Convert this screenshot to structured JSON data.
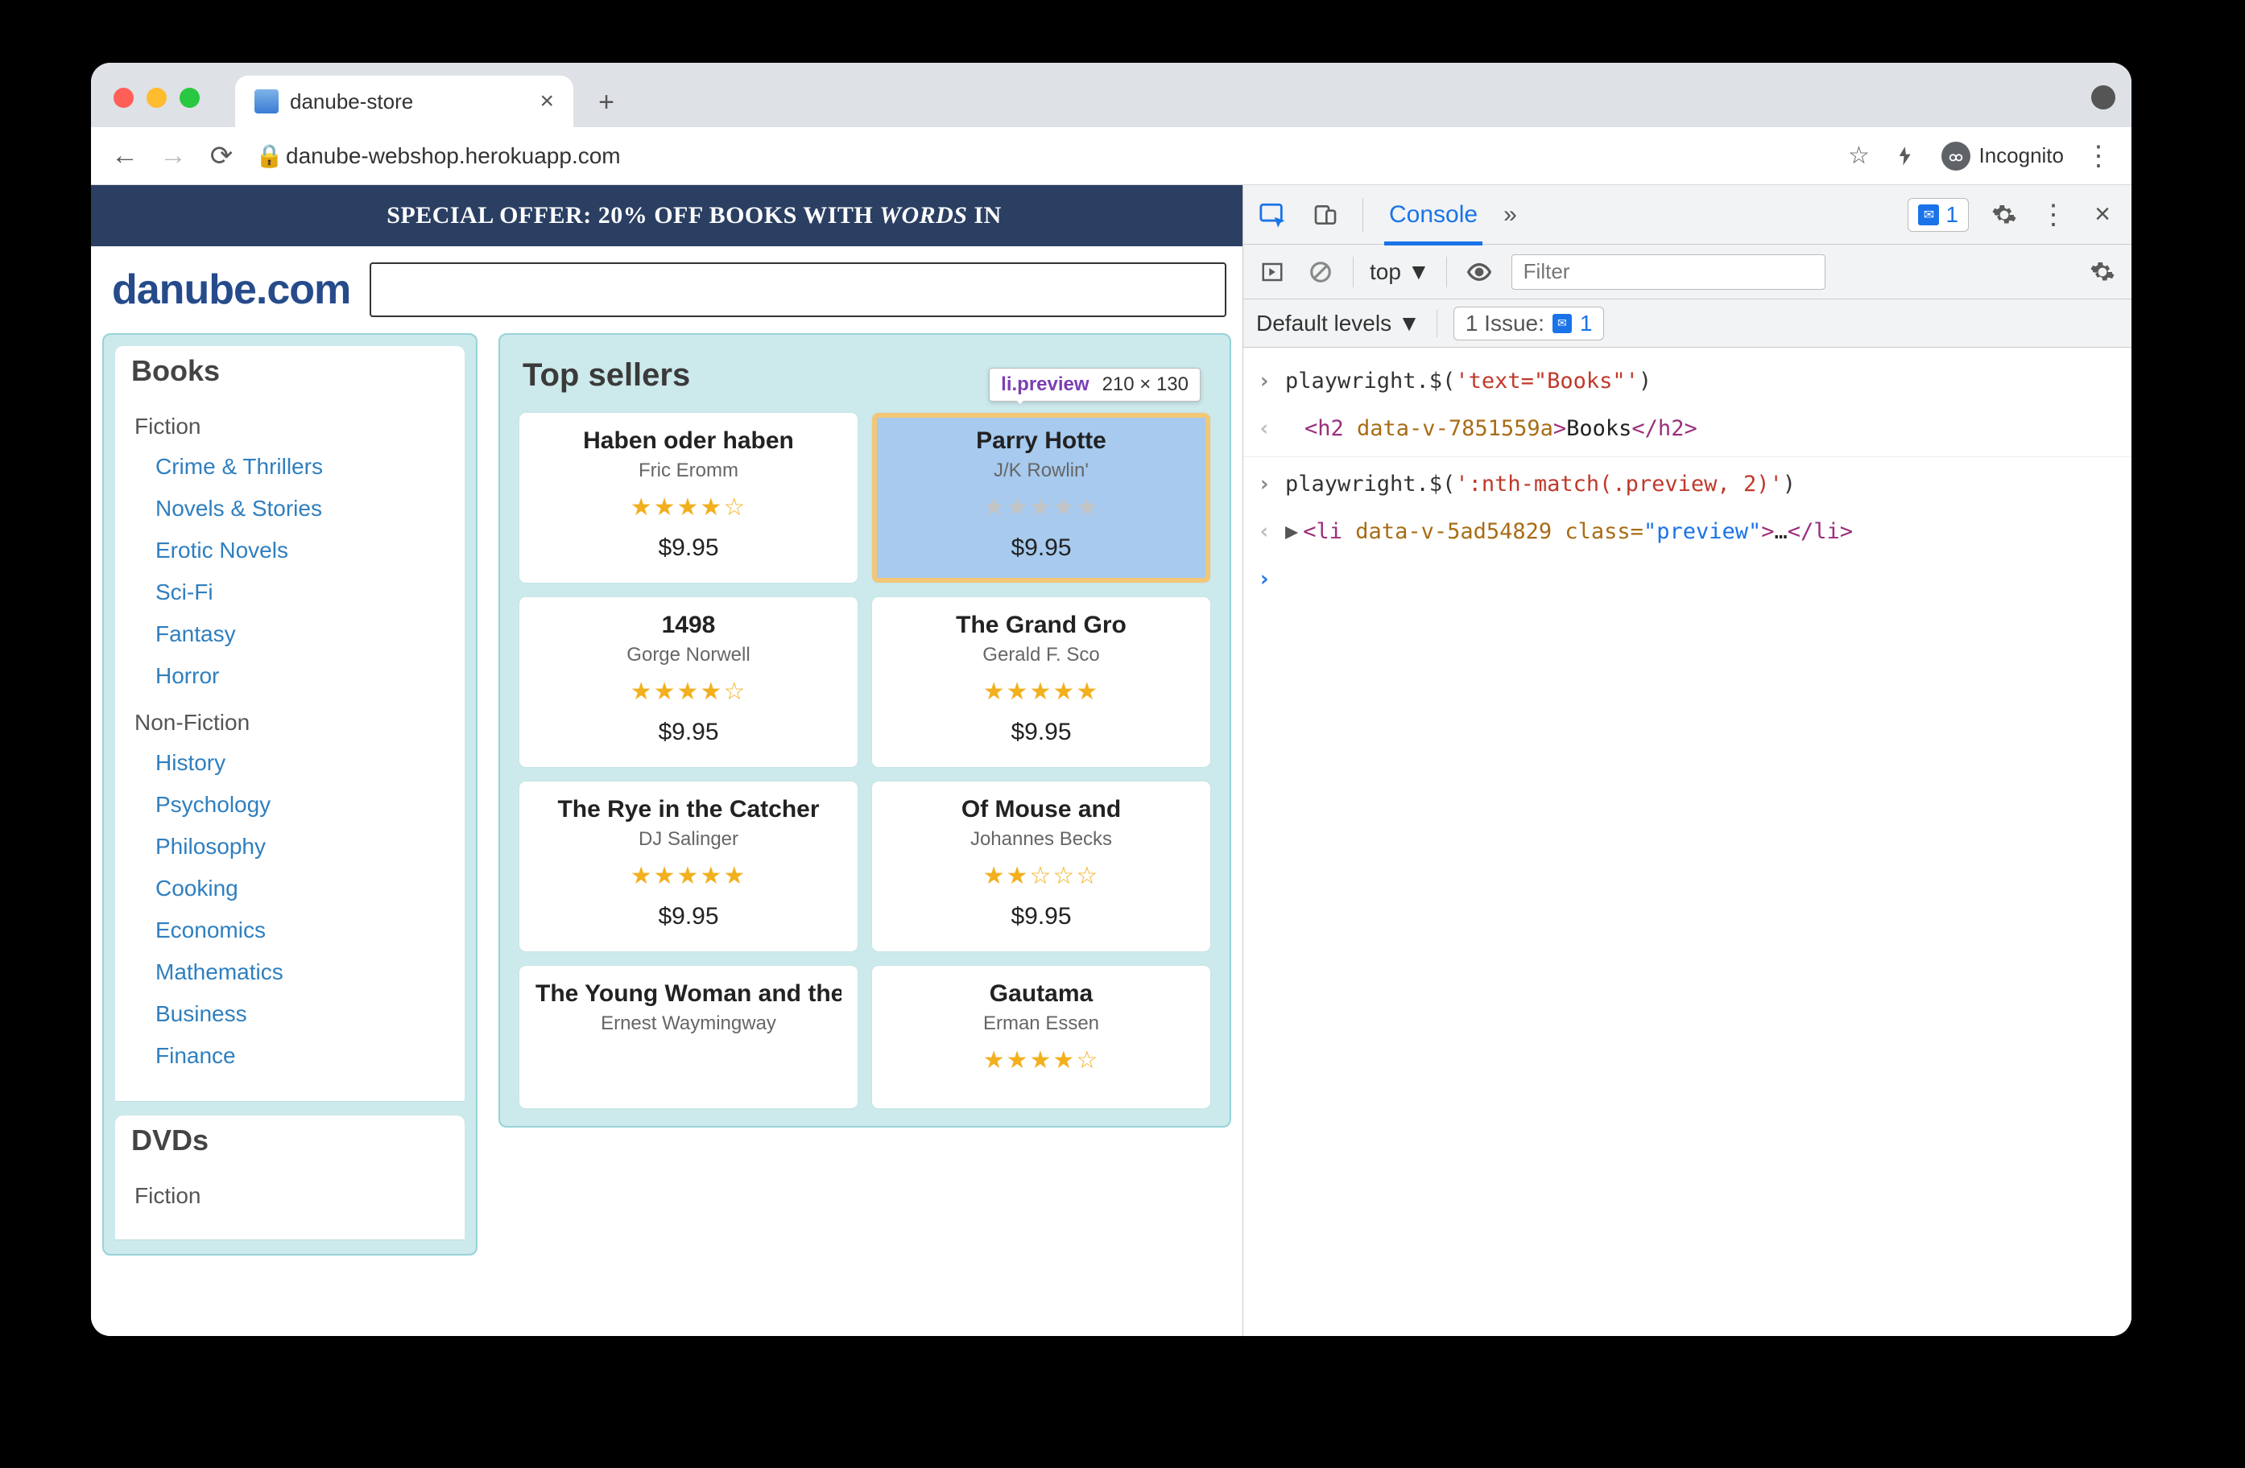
{
  "browser": {
    "tab_title": "danube-store",
    "url": "danube-webshop.herokuapp.com",
    "incognito_label": "Incognito"
  },
  "page": {
    "banner_prefix": "SPECIAL OFFER: 20% OFF BOOKS WITH ",
    "banner_em": "WORDS",
    "banner_suffix": " IN",
    "logo": "danube.com",
    "tooltip_tag": "li.preview",
    "tooltip_dims": "210 × 130",
    "sidebar": {
      "blocks": [
        {
          "title": "Books",
          "groups": [
            {
              "heading": "Fiction",
              "links": [
                "Crime & Thrillers",
                "Novels & Stories",
                "Erotic Novels",
                "Sci-Fi",
                "Fantasy",
                "Horror"
              ]
            },
            {
              "heading": "Non-Fiction",
              "links": [
                "History",
                "Psychology",
                "Philosophy",
                "Cooking",
                "Economics",
                "Mathematics",
                "Business",
                "Finance"
              ]
            }
          ]
        },
        {
          "title": "DVDs",
          "groups": [
            {
              "heading": "Fiction",
              "links": []
            }
          ]
        }
      ]
    },
    "main_heading": "Top sellers",
    "products": [
      {
        "title": "Haben oder haben",
        "author": "Fric Eromm",
        "price": "$9.95",
        "stars": "★★★★☆",
        "highlight": false
      },
      {
        "title": "Parry Hotte",
        "author": "J/K Rowlin'",
        "price": "$9.95",
        "stars": "★★★★★",
        "highlight": true
      },
      {
        "title": "1498",
        "author": "Gorge Norwell",
        "price": "$9.95",
        "stars": "★★★★☆",
        "highlight": false
      },
      {
        "title": "The Grand Gro",
        "author": "Gerald F. Sco",
        "price": "$9.95",
        "stars": "★★★★★",
        "highlight": false
      },
      {
        "title": "The Rye in the Catcher",
        "author": "DJ Salinger",
        "price": "$9.95",
        "stars": "★★★★★",
        "highlight": false
      },
      {
        "title": "Of Mouse and",
        "author": "Johannes Becks",
        "price": "$9.95",
        "stars": "★★☆☆☆",
        "highlight": false
      },
      {
        "title": "The Young Woman and the Mountain",
        "author": "Ernest Waymingway",
        "price": "",
        "stars": "",
        "highlight": false
      },
      {
        "title": "Gautama",
        "author": "Erman Essen",
        "price": "",
        "stars": "★★★★☆",
        "highlight": false
      }
    ]
  },
  "devtools": {
    "tab_active": "Console",
    "issue_count": "1",
    "context": "top",
    "filter_placeholder": "Filter",
    "levels_label": "Default levels",
    "issues_label": "1 Issue:",
    "issues_count2": "1",
    "console_lines": {
      "l1_code": "playwright.$(",
      "l1_str": "'text=\"Books\"'",
      "l1_end": ")",
      "l2_open": "<h2 ",
      "l2_attr": "data-v-7851559a",
      "l2_mid": ">",
      "l2_txt": "Books",
      "l2_close": "</h2>",
      "l3_code": "playwright.$(",
      "l3_str": "':nth-match(.preview, 2)'",
      "l3_end": ")",
      "l4_open": "<li ",
      "l4_attr": "data-v-5ad54829",
      "l4_cls_k": " class=",
      "l4_cls_v": "\"preview\"",
      "l4_mid": ">",
      "l4_ell": "…",
      "l4_close": "</li>"
    }
  }
}
